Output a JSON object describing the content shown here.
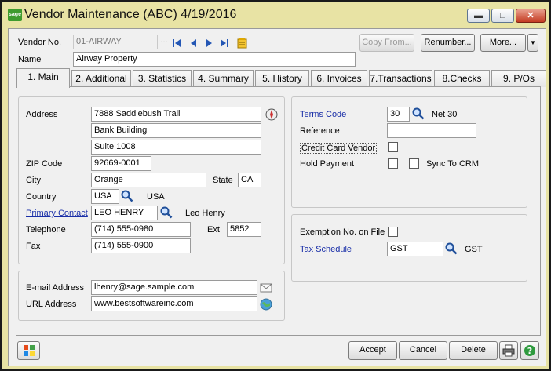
{
  "window": {
    "title": "Vendor Maintenance (ABC) 4/19/2016",
    "logo_text": "sage"
  },
  "header": {
    "vendor_no_label": "Vendor No.",
    "vendor_no_value": "01-AIRWAY",
    "name_label": "Name",
    "name_value": "Airway Property",
    "copy_from_label": "Copy From...",
    "renumber_label": "Renumber...",
    "more_label": "More..."
  },
  "tabs": [
    {
      "label": "1. Main"
    },
    {
      "label": "2. Additional"
    },
    {
      "label": "3. Statistics"
    },
    {
      "label": "4. Summary"
    },
    {
      "label": "5. History"
    },
    {
      "label": "6. Invoices"
    },
    {
      "label": "7.Transactions"
    },
    {
      "label": "8.Checks"
    },
    {
      "label": "9. P/Os"
    }
  ],
  "address": {
    "address_label": "Address",
    "line1": "7888 Saddlebush Trail",
    "line2": "Bank Building",
    "line3": "Suite 1008",
    "zip_label": "ZIP Code",
    "zip_value": "92669-0001",
    "city_label": "City",
    "city_value": "Orange",
    "state_label": "State",
    "state_value": "CA",
    "country_label": "Country",
    "country_value": "USA",
    "country_desc": "USA",
    "contact_label": "Primary Contact",
    "contact_value": "LEO HENRY",
    "contact_desc": "Leo Henry",
    "telephone_label": "Telephone",
    "telephone_value": "(714) 555-0980",
    "ext_label": "Ext",
    "ext_value": "5852",
    "fax_label": "Fax",
    "fax_value": "(714) 555-0900"
  },
  "contact": {
    "email_label": "E-mail Address",
    "email_value": "lhenry@sage.sample.com",
    "url_label": "URL Address",
    "url_value": "www.bestsoftwareinc.com"
  },
  "terms": {
    "terms_code_label": "Terms Code",
    "terms_code_value": "30",
    "terms_desc": "Net 30",
    "reference_label": "Reference",
    "reference_value": "",
    "credit_card_label": "Credit Card Vendor",
    "hold_payment_label": "Hold Payment",
    "sync_crm_label": "Sync To CRM"
  },
  "tax": {
    "exemption_label": "Exemption No. on File",
    "tax_schedule_label": "Tax Schedule",
    "tax_schedule_value": "GST",
    "tax_schedule_desc": "GST"
  },
  "footer": {
    "accept_label": "Accept",
    "cancel_label": "Cancel",
    "delete_label": "Delete"
  },
  "icons": {
    "accent": "#e8e3a4",
    "link_color": "#1a2fa8"
  }
}
